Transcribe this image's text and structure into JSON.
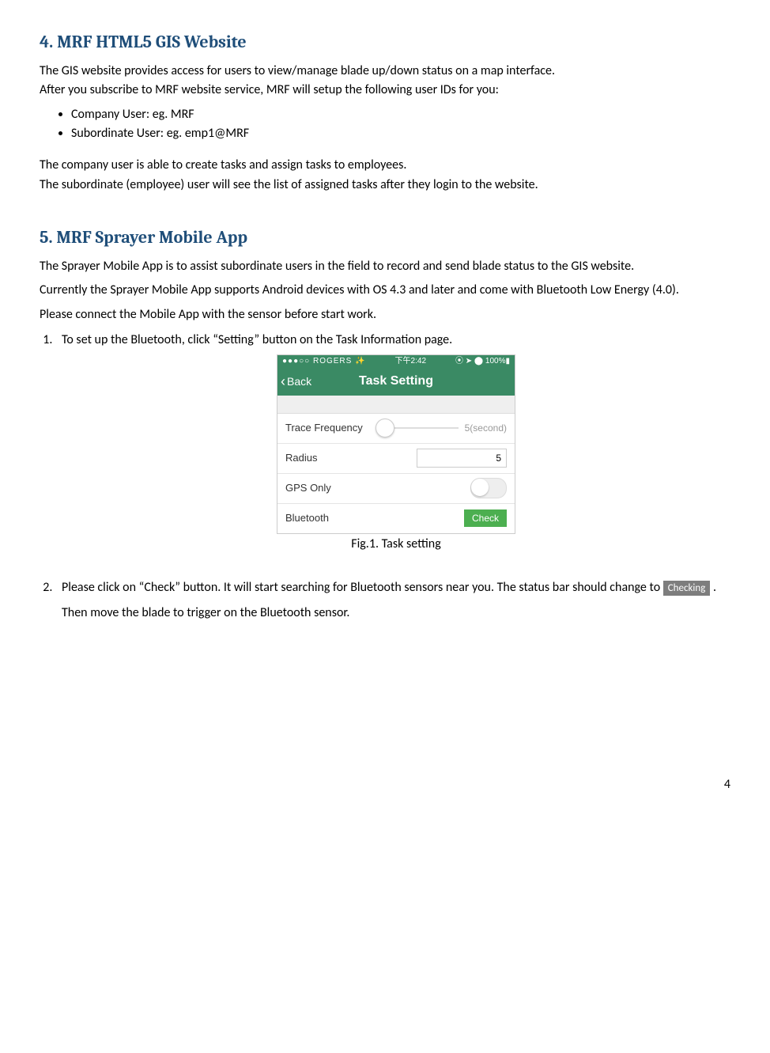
{
  "section4": {
    "heading": "4. MRF HTML5 GIS Website",
    "intro1": "The GIS website provides access for users to view/manage blade up/down status on a map interface.",
    "intro2": "After you subscribe to MRF website service, MRF will setup the following user IDs for you:",
    "bullets": [
      "Company User:   eg. MRF",
      "Subordinate User:  eg. emp1@MRF"
    ],
    "para3": "The company user is able to create tasks and assign tasks to employees.",
    "para4": "The subordinate (employee) user will see the list of assigned tasks after they login to the website."
  },
  "section5": {
    "heading": "5. MRF Sprayer Mobile App",
    "para1": "The Sprayer Mobile App is to assist subordinate users in the field to record and send blade status to the GIS website.",
    "para2": "Currently the Sprayer Mobile App supports Android devices with OS 4.3 and later and come with Bluetooth Low Energy (4.0).",
    "para3": "Please connect the Mobile App with the sensor before start work.",
    "step1": "To set up the Bluetooth, click “Setting” button on the Task Information page.",
    "step2_a": "Please click on “Check” button. It will start searching for Bluetooth sensors near you. The status bar should change to ",
    "step2_b": ". Then move the blade to trigger on the Bluetooth sensor.",
    "checking_label": "Checking"
  },
  "figure1": {
    "caption": "Fig.1. Task setting",
    "statusbar_left": "●●●○○ ROGERS ✨",
    "statusbar_time": "下午2:42",
    "statusbar_right": "⦿ ➤ ⬤ 100%▮",
    "back": "Back",
    "title": "Task Setting",
    "rows": {
      "trace_label": "Trace Frequency",
      "trace_value": "5(second)",
      "radius_label": "Radius",
      "radius_value": "5",
      "gps_label": "GPS Only",
      "bt_label": "Bluetooth",
      "check_label": "Check"
    }
  },
  "page_number": "4"
}
